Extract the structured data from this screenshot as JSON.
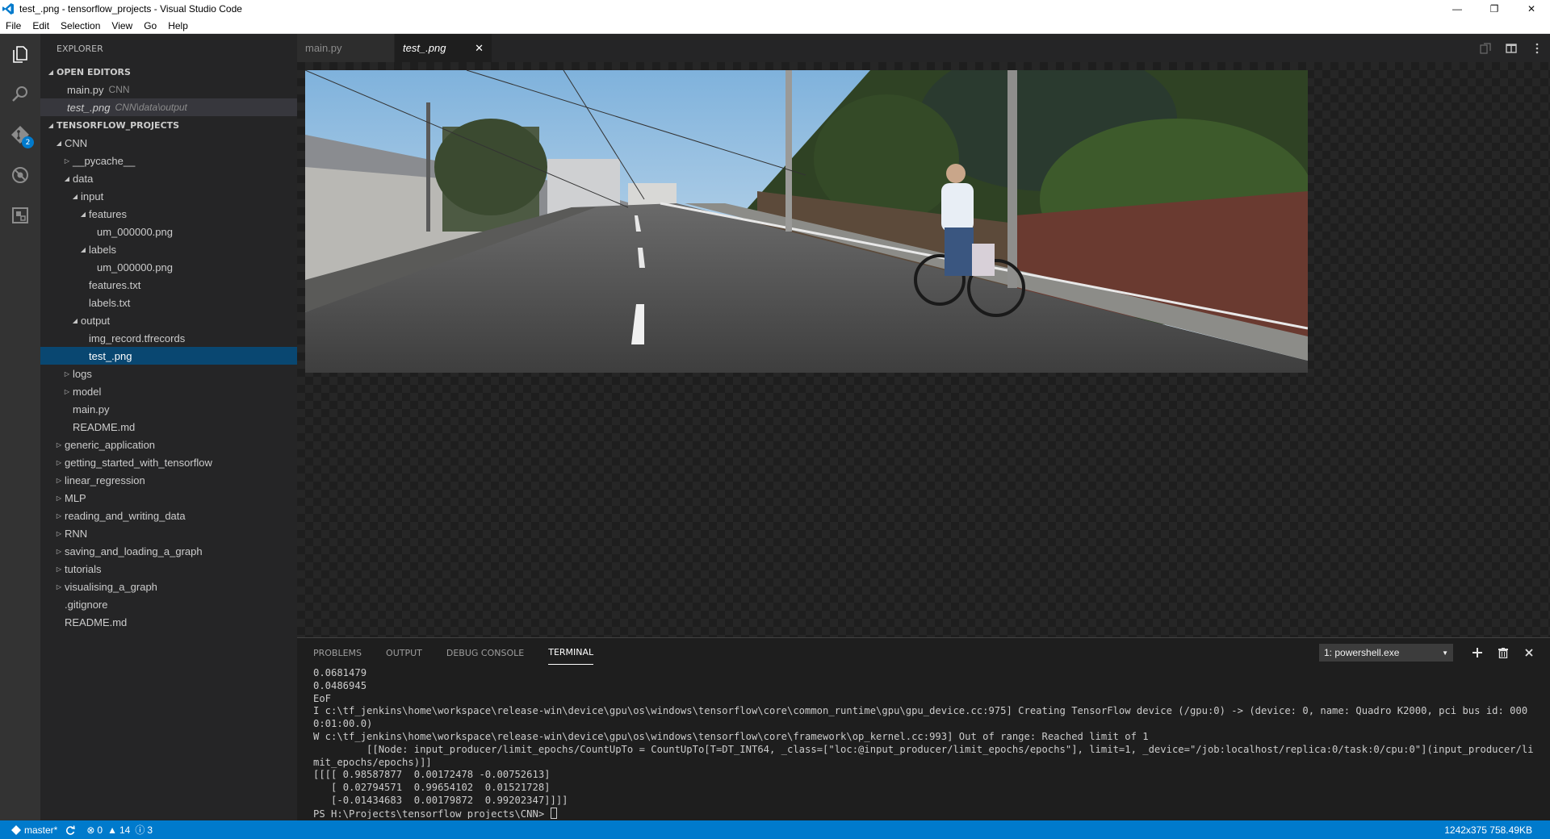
{
  "window": {
    "title": "test_.png - tensorflow_projects - Visual Studio Code",
    "controls": {
      "minimize": "—",
      "restore": "❐",
      "close": "✕"
    }
  },
  "menu": [
    "File",
    "Edit",
    "Selection",
    "View",
    "Go",
    "Help"
  ],
  "activity_bar": {
    "items": [
      {
        "icon": "files-icon"
      },
      {
        "icon": "search-icon"
      },
      {
        "icon": "git-icon",
        "badge": "2"
      },
      {
        "icon": "debug-icon"
      },
      {
        "icon": "extensions-icon"
      }
    ]
  },
  "sidebar": {
    "title": "EXPLORER",
    "open_editors_header": "OPEN EDITORS",
    "open_editors": [
      {
        "name": "main.py",
        "desc": "CNN"
      },
      {
        "name": "test_.png",
        "desc": "CNN\\data\\output"
      }
    ],
    "project_header": "TENSORFLOW_PROJECTS",
    "tree": [
      {
        "label": "CNN",
        "level": 1,
        "twisty": "open"
      },
      {
        "label": "__pycache__",
        "level": 2,
        "twisty": "closed"
      },
      {
        "label": "data",
        "level": 2,
        "twisty": "open"
      },
      {
        "label": "input",
        "level": 3,
        "twisty": "open"
      },
      {
        "label": "features",
        "level": 4,
        "twisty": "open"
      },
      {
        "label": "um_000000.png",
        "level": 5,
        "twisty": "none"
      },
      {
        "label": "labels",
        "level": 4,
        "twisty": "open"
      },
      {
        "label": "um_000000.png",
        "level": 5,
        "twisty": "none"
      },
      {
        "label": "features.txt",
        "level": 4,
        "twisty": "none"
      },
      {
        "label": "labels.txt",
        "level": 4,
        "twisty": "none"
      },
      {
        "label": "output",
        "level": 3,
        "twisty": "open"
      },
      {
        "label": "img_record.tfrecords",
        "level": 4,
        "twisty": "none"
      },
      {
        "label": "test_.png",
        "level": 4,
        "twisty": "none",
        "selected": true
      },
      {
        "label": "logs",
        "level": 2,
        "twisty": "closed"
      },
      {
        "label": "model",
        "level": 2,
        "twisty": "closed"
      },
      {
        "label": "main.py",
        "level": 2,
        "twisty": "none"
      },
      {
        "label": "README.md",
        "level": 2,
        "twisty": "none"
      },
      {
        "label": "generic_application",
        "level": 1,
        "twisty": "closed"
      },
      {
        "label": "getting_started_with_tensorflow",
        "level": 1,
        "twisty": "closed"
      },
      {
        "label": "linear_regression",
        "level": 1,
        "twisty": "closed"
      },
      {
        "label": "MLP",
        "level": 1,
        "twisty": "closed"
      },
      {
        "label": "reading_and_writing_data",
        "level": 1,
        "twisty": "closed"
      },
      {
        "label": "RNN",
        "level": 1,
        "twisty": "closed"
      },
      {
        "label": "saving_and_loading_a_graph",
        "level": 1,
        "twisty": "closed"
      },
      {
        "label": "tutorials",
        "level": 1,
        "twisty": "closed"
      },
      {
        "label": "visualising_a_graph",
        "level": 1,
        "twisty": "closed"
      },
      {
        "label": ".gitignore",
        "level": 1,
        "twisty": "none"
      },
      {
        "label": "README.md",
        "level": 1,
        "twisty": "none"
      }
    ]
  },
  "tabs": [
    {
      "label": "main.py",
      "active": false
    },
    {
      "label": "test_.png",
      "active": true,
      "close": "✕"
    }
  ],
  "panel": {
    "tabs": [
      "PROBLEMS",
      "OUTPUT",
      "DEBUG CONSOLE",
      "TERMINAL"
    ],
    "active_tab": "TERMINAL",
    "terminal_select": "1: powershell.exe",
    "terminal_lines": [
      "0.0681479",
      "0.0486945",
      "EoF",
      "I c:\\tf_jenkins\\home\\workspace\\release-win\\device\\gpu\\os\\windows\\tensorflow\\core\\common_runtime\\gpu\\gpu_device.cc:975] Creating TensorFlow device (/gpu:0) -> (device: 0, name: Quadro K2000, pci bus id: 0000:01:00.0)",
      "W c:\\tf_jenkins\\home\\workspace\\release-win\\device\\gpu\\os\\windows\\tensorflow\\core\\framework\\op_kernel.cc:993] Out of range: Reached limit of 1",
      "         [[Node: input_producer/limit_epochs/CountUpTo = CountUpTo[T=DT_INT64, _class=[\"loc:@input_producer/limit_epochs/epochs\"], limit=1, _device=\"/job:localhost/replica:0/task:0/cpu:0\"](input_producer/limit_epochs/epochs)]]",
      "[[[[ 0.98587877  0.00172478 -0.00752613]",
      "   [ 0.02794571  0.99654102  0.01521728]",
      "   [-0.01434683  0.00179872  0.99202347]]]]"
    ],
    "prompt": "PS H:\\Projects\\tensorflow_projects\\CNN> "
  },
  "status_bar": {
    "branch": "master*",
    "errors": "0",
    "warnings": "14",
    "infos": "3",
    "image_info": "1242x375 758.49KB"
  },
  "colors": {
    "accent": "#007acc",
    "selection": "#094771",
    "sidebar_bg": "#252526",
    "editor_bg": "#1e1e1e"
  }
}
